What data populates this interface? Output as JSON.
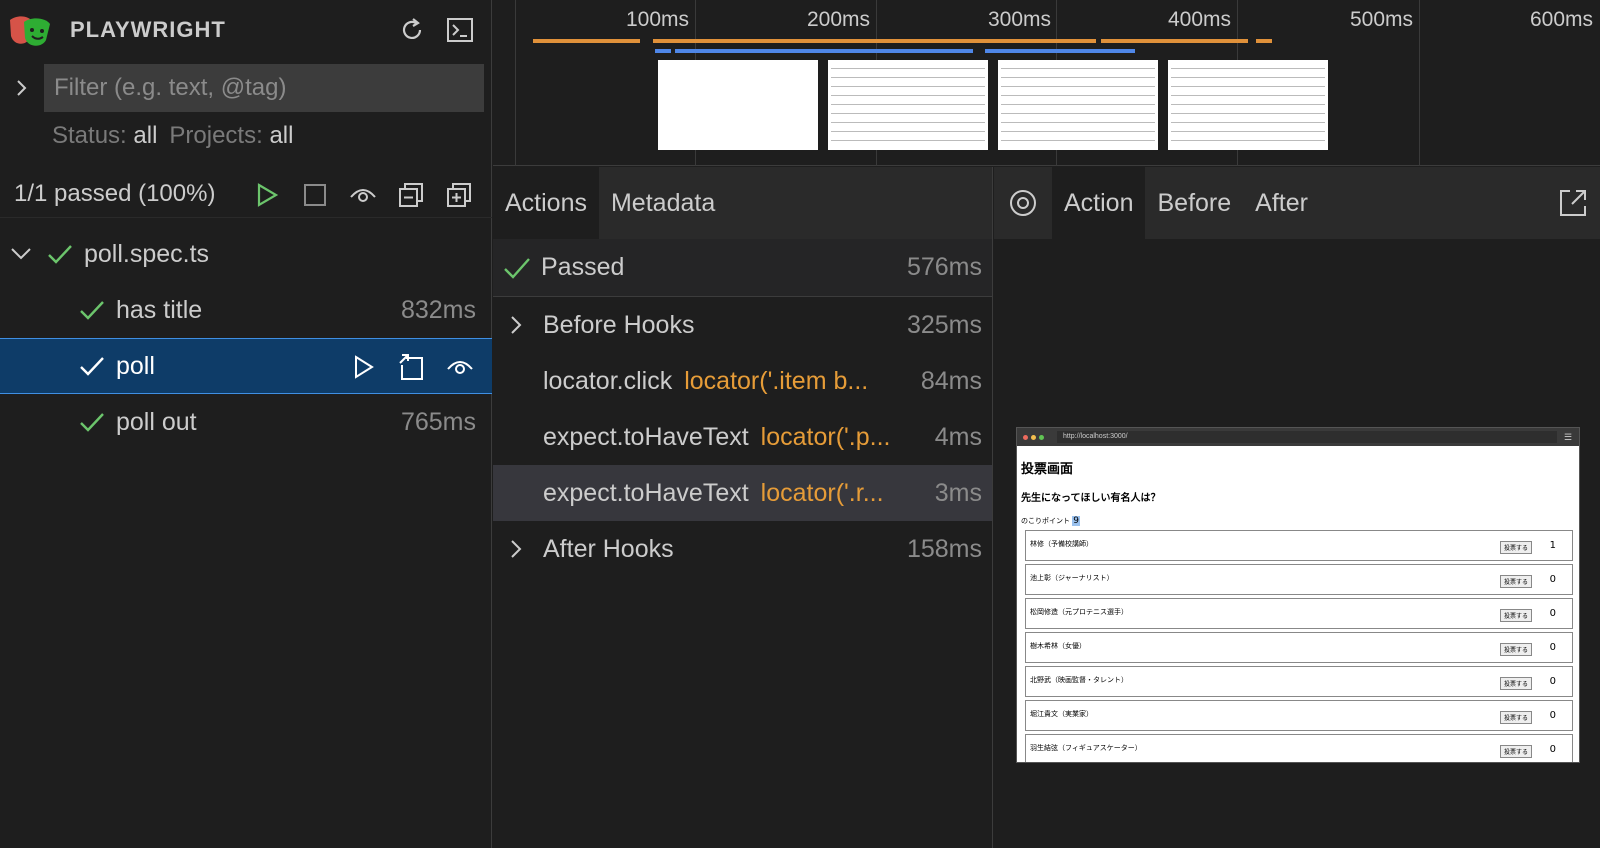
{
  "app": {
    "title": "PLAYWRIGHT"
  },
  "filter": {
    "placeholder": "Filter (e.g. text, @tag)"
  },
  "status": {
    "status_label": "Status:",
    "status_value": "all",
    "projects_label": "Projects:",
    "projects_value": "all"
  },
  "summary": {
    "text": "1/1 passed (100%)"
  },
  "tree": {
    "file": "poll.spec.ts",
    "tests": [
      {
        "name": "has title",
        "duration": "832ms"
      },
      {
        "name": "poll",
        "duration": ""
      },
      {
        "name": "poll out",
        "duration": "765ms"
      }
    ]
  },
  "timeline": {
    "ticks": [
      "100ms",
      "200ms",
      "300ms",
      "400ms",
      "500ms",
      "600ms"
    ]
  },
  "actions_panel": {
    "tabs": [
      "Actions",
      "Metadata"
    ],
    "passed_label": "Passed",
    "passed_duration": "576ms",
    "rows": [
      {
        "title": "Before Hooks",
        "selector": "",
        "duration": "325ms"
      },
      {
        "title": "locator.click",
        "selector": "locator('.item b...",
        "duration": "84ms"
      },
      {
        "title": "expect.toHaveText",
        "selector": "locator('.p...",
        "duration": "4ms"
      },
      {
        "title": "expect.toHaveText",
        "selector": "locator('.r...",
        "duration": "3ms"
      },
      {
        "title": "After Hooks",
        "selector": "",
        "duration": "158ms"
      }
    ]
  },
  "snapshot_panel": {
    "tabs": [
      "Action",
      "Before",
      "After"
    ]
  },
  "browser": {
    "url": "http://localhost:3000/",
    "heading": "投票画面",
    "question": "先生になってほしい有名人は？",
    "points_label": "のこりポイント",
    "points_value": "9",
    "vote_label": "投票する",
    "candidates": [
      {
        "name": "林修（予備校講師）",
        "count": "1"
      },
      {
        "name": "池上彰（ジャーナリスト）",
        "count": "0"
      },
      {
        "name": "松岡修造（元プロテニス選手）",
        "count": "0"
      },
      {
        "name": "樹木希林（女優）",
        "count": "0"
      },
      {
        "name": "北野武（映画監督・タレント）",
        "count": "0"
      },
      {
        "name": "堀江貴文（実業家）",
        "count": "0"
      },
      {
        "name": "羽生結弦（フィギュアスケーター）",
        "count": "0"
      }
    ]
  },
  "colors": {
    "accent_green": "#6cc56c",
    "selector_orange": "#e69c38",
    "selection_blue": "#0e3c68",
    "timeline_blue": "#4f87e8"
  }
}
